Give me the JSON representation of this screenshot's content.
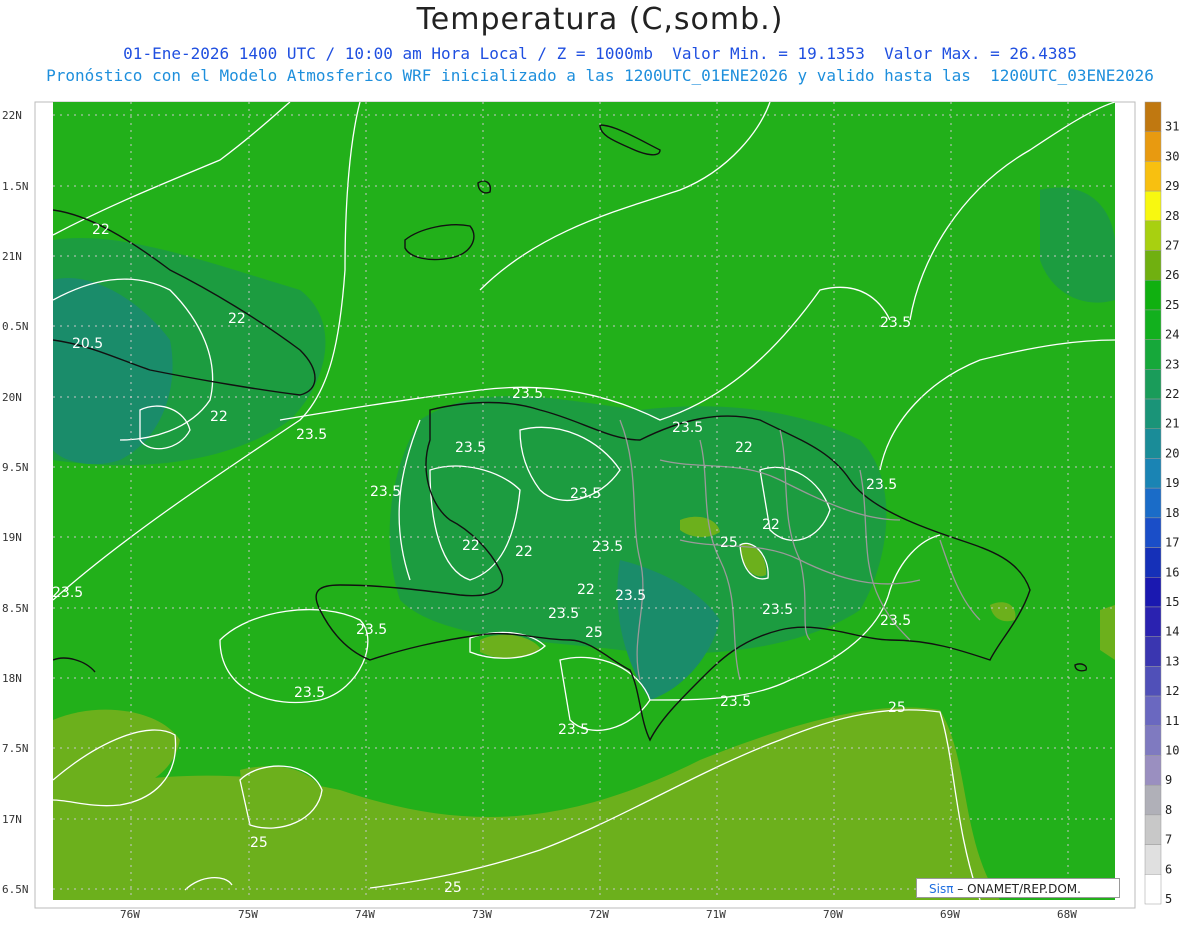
{
  "title": "Temperatura (C,somb.)",
  "subtitle1": "01-Ene-2026 1400 UTC / 10:00 am Hora Local / Z = 1000mb  Valor Min. = 19.1353  Valor Max. = 26.4385",
  "subtitle2": "Pronóstico con el Modelo Atmosferico WRF inicializado a las 1200UTC_01ENE2026 y valido hasta las  1200UTC_03ENE2026",
  "credit": {
    "brand": "Sisπ",
    "text": "– ONAMET/REP.DOM."
  },
  "y_axis_labels": [
    "22N",
    "1.5N",
    "21N",
    "0.5N",
    "20N",
    "9.5N",
    "19N",
    "8.5N",
    "18N",
    "7.5N",
    "17N",
    "6.5N"
  ],
  "x_axis_labels": [
    "76W",
    "75W",
    "74W",
    "73W",
    "72W",
    "71W",
    "70W",
    "69W",
    "68W"
  ],
  "contour_labels": [
    "22",
    "22",
    "20.5",
    "22",
    "23.5",
    "23.5",
    "23.5",
    "23.5",
    "23.5",
    "23.5",
    "22",
    "22",
    "22",
    "22",
    "23.5",
    "23.5",
    "23.5",
    "23.5",
    "22",
    "25",
    "23.5",
    "23.5",
    "25",
    "23.5",
    "23.5",
    "23.5",
    "23.5",
    "25",
    "25",
    "25",
    "23.5",
    "23.5"
  ],
  "colorbar": {
    "values": [
      "5",
      "6",
      "7",
      "8",
      "9",
      "10",
      "11",
      "12",
      "13",
      "14",
      "15",
      "16",
      "17",
      "18",
      "19",
      "20",
      "21",
      "22",
      "23",
      "24",
      "25",
      "26",
      "27",
      "28",
      "29",
      "30",
      "31"
    ],
    "colors": [
      "#ffffff",
      "#e0e0e0",
      "#c8c8c8",
      "#b0b0b8",
      "#9a8fc0",
      "#7f7ac0",
      "#6a68c0",
      "#5050b8",
      "#3a36b0",
      "#2a22b0",
      "#1a18b0",
      "#1530b8",
      "#1a4ec8",
      "#1a6cc8",
      "#1a84b4",
      "#1a8c98",
      "#1a9478",
      "#1a9c5a",
      "#16a83a",
      "#12b01e",
      "#10b010",
      "#70b010",
      "#a8d010",
      "#f8f810",
      "#f8c010",
      "#e89a10",
      "#c07810"
    ]
  },
  "colors": {
    "sea_green": "#22b01a",
    "warm_olive": "#6cb01c",
    "cool_teal": "#1a8c6a",
    "mid_green": "#1c9c40"
  }
}
